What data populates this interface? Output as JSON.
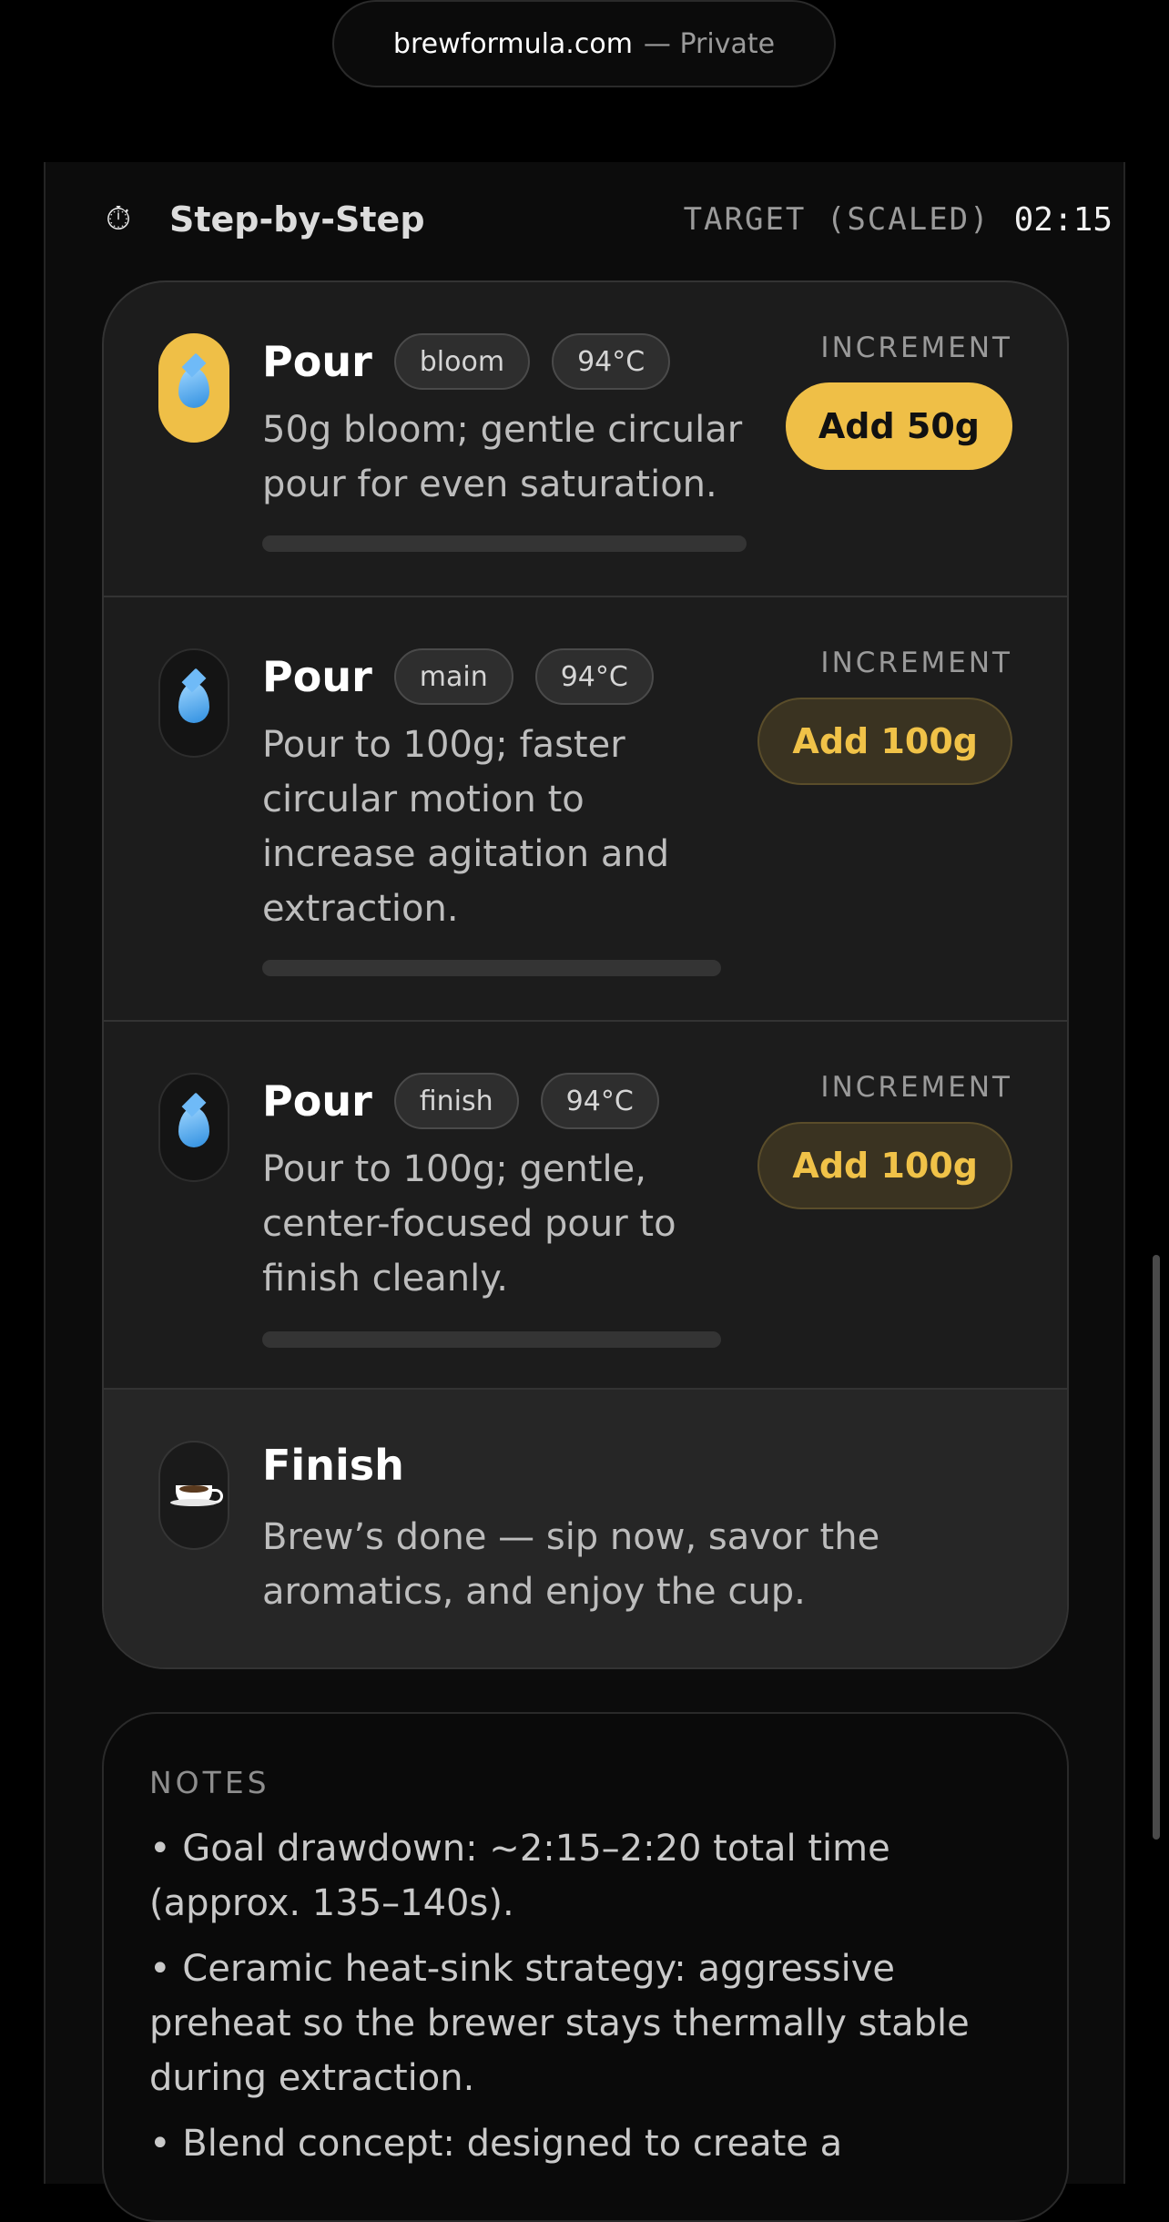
{
  "browser": {
    "domain": "brewformula.com",
    "mode": "— Private"
  },
  "section": {
    "icon": "stopwatch-icon",
    "title": "Step-by-Step",
    "target_label": "TARGET (SCALED)",
    "target_time": "02:15"
  },
  "steps": [
    {
      "icon": "droplet-icon",
      "name": "Pour",
      "tag": "bloom",
      "temp": "94°C",
      "desc": "50g bloom; gentle circular pour for even saturation.",
      "increment_label": "INCREMENT",
      "button": "Add 50g"
    },
    {
      "icon": "droplet-icon",
      "name": "Pour",
      "tag": "main",
      "temp": "94°C",
      "desc": "Pour to 100g; faster circular motion to increase agitation and extraction.",
      "increment_label": "INCREMENT",
      "button": "Add 100g"
    },
    {
      "icon": "droplet-icon",
      "name": "Pour",
      "tag": "finish",
      "temp": "94°C",
      "desc": "Pour to 100g; gentle, center-focused pour to finish cleanly.",
      "increment_label": "INCREMENT",
      "button": "Add 100g"
    },
    {
      "icon": "coffee-cup-icon",
      "name": "Finish",
      "desc": "Brew’s done — sip now, savor the aromatics, and enjoy the cup."
    }
  ],
  "notes": {
    "label": "NOTES",
    "items": [
      "• Goal drawdown: ~2:15–2:20 total time (approx. 135–140s).",
      "• Ceramic heat-sink strategy: aggressive preheat so the brewer stays thermally stable during extraction.",
      "• Blend concept: designed to create a"
    ]
  },
  "colors": {
    "accent": "#efbf47",
    "background": "#000000",
    "card": "#1c1c1c"
  }
}
